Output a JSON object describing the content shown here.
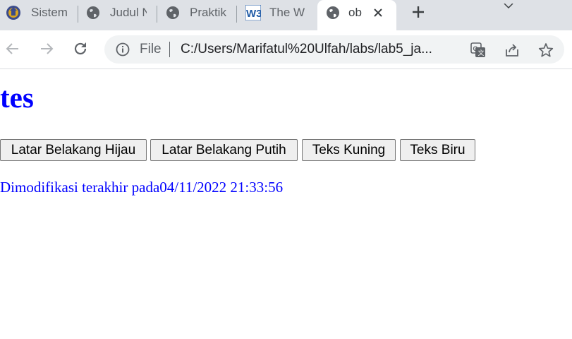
{
  "browser": {
    "tabs": [
      {
        "label": "Sistem",
        "icon": "university-logo-icon"
      },
      {
        "label": "Judul N",
        "icon": "globe-icon"
      },
      {
        "label": "Praktik",
        "icon": "globe-icon"
      },
      {
        "label": "The W",
        "icon": "w3schools-icon"
      },
      {
        "label": "ob",
        "icon": "globe-icon",
        "active": true
      }
    ],
    "omnibox": {
      "scheme_label": "File",
      "url": "C:/Users/Marifatul%20Ulfah/labs/lab5_ja..."
    }
  },
  "page": {
    "heading": "tes",
    "buttons": [
      "Latar Belakang Hijau",
      "Latar Belakang Putih",
      "Teks Kuning",
      "Teks Biru"
    ],
    "modified_text": "Dimodifikasi terakhir pada04/11/2022 21:33:56"
  },
  "colors": {
    "page_text": "#0000ff",
    "tabstrip": "#dee1e6",
    "omnibox": "#f1f3f4"
  }
}
